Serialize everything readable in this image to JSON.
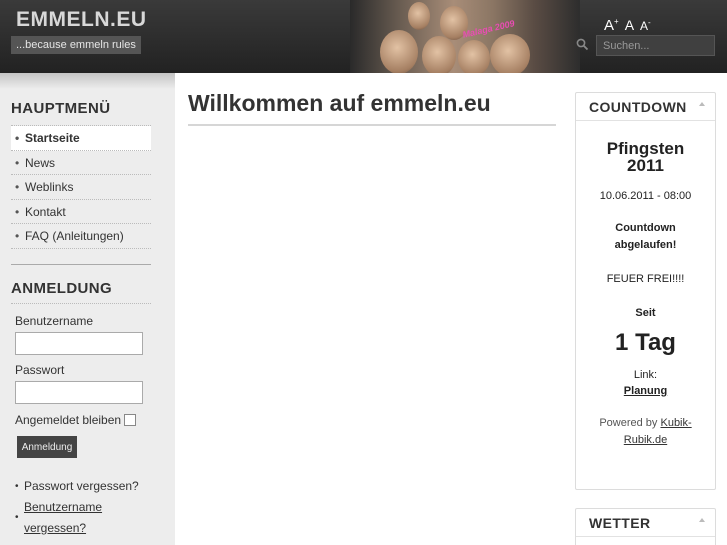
{
  "header": {
    "site_title": "EMMELN.EU",
    "slogan": "...because emmeln rules",
    "photo_caption": "Malaga 2009",
    "fontsize": {
      "bigger": "A",
      "bigger_sup": "+",
      "reset": "A",
      "smaller": "A",
      "smaller_sup": "-"
    },
    "search": {
      "placeholder": "Suchen...",
      "value": "",
      "icon": "search-icon"
    }
  },
  "sidebar": {
    "menu_title": "HAUPTMENÜ",
    "menu_items": [
      {
        "label": "Startseite",
        "active": true
      },
      {
        "label": "News"
      },
      {
        "label": "Weblinks"
      },
      {
        "label": "Kontakt"
      },
      {
        "label": "FAQ (Anleitungen)"
      }
    ],
    "login": {
      "title": "ANMELDUNG",
      "username_label": "Benutzername",
      "username_value": "",
      "password_label": "Passwort",
      "password_value": "",
      "remember_label": "Angemeldet bleiben",
      "remember_checked": false,
      "button_label": "Anmeldung",
      "forgot_password": "Passwort vergessen?",
      "forgot_username_1": "Benutzername",
      "forgot_username_2": "vergessen?"
    }
  },
  "main": {
    "title": "Willkommen auf emmeln.eu"
  },
  "countdown": {
    "title": "COUNTDOWN",
    "event_line1": "Pfingsten",
    "event_line2": "2011",
    "date": "10.06.2011 - 08:00",
    "status_line1": "Countdown",
    "status_line2": "abgelaufen!",
    "fire": "FEUER FREI!!!!",
    "since": "Seit",
    "days": "1 Tag",
    "link_label": "Link:",
    "link_text": "Planung",
    "powered_by": "Powered by",
    "powered_link_1": "Kubik-",
    "powered_link_2": "Rubik.de"
  },
  "weather": {
    "title": "WETTER"
  }
}
